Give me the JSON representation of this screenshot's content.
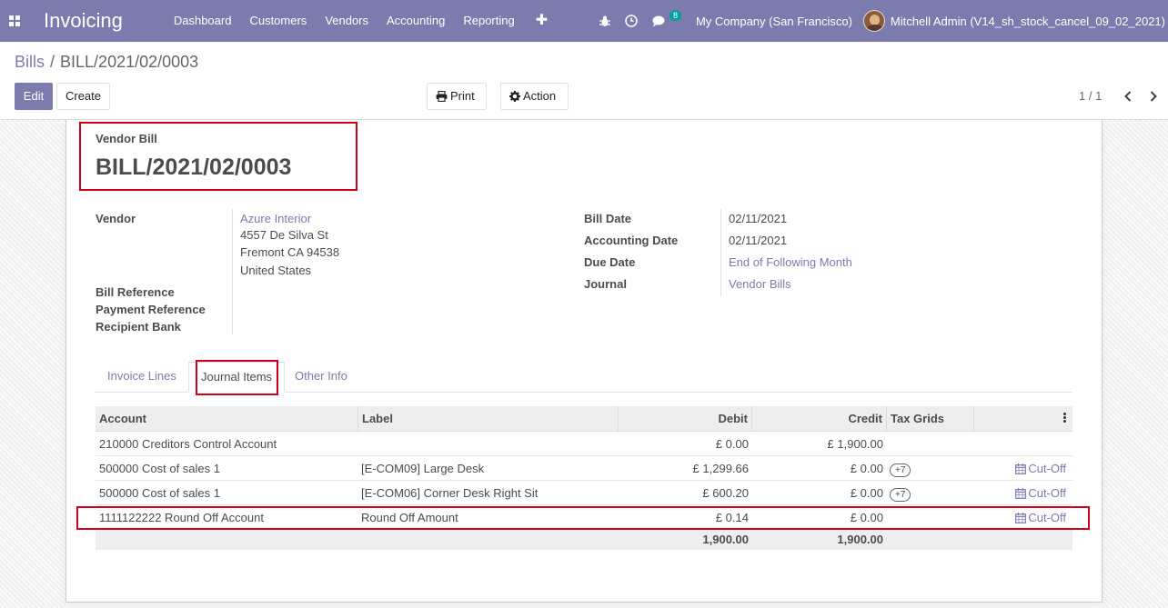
{
  "navbar": {
    "app_title": "Invoicing",
    "menu": [
      "Dashboard",
      "Customers",
      "Vendors",
      "Accounting",
      "Reporting"
    ],
    "chat_count": "8",
    "company": "My Company (San Francisco)",
    "user": "Mitchell Admin (V14_sh_stock_cancel_09_02_2021)"
  },
  "breadcrumb": {
    "parent": "Bills",
    "current": "BILL/2021/02/0003"
  },
  "toolbar": {
    "edit": "Edit",
    "create": "Create",
    "print": "Print",
    "action": "Action",
    "pager": "1 / 1"
  },
  "form": {
    "doc_type": "Vendor Bill",
    "doc_name": "BILL/2021/02/0003",
    "vendor_label": "Vendor",
    "vendor_name": "Azure Interior",
    "vendor_addr1": "4557 De Silva St",
    "vendor_addr2": "Fremont CA 94538",
    "vendor_addr3": "United States",
    "bill_ref_label": "Bill Reference",
    "pay_ref_label": "Payment Reference",
    "bank_label": "Recipient Bank",
    "bill_date_label": "Bill Date",
    "bill_date": "02/11/2021",
    "acc_date_label": "Accounting Date",
    "acc_date": "02/11/2021",
    "due_date_label": "Due Date",
    "due_date": "End of Following Month",
    "journal_label": "Journal",
    "journal": "Vendor Bills"
  },
  "tabs": [
    "Invoice Lines",
    "Journal Items",
    "Other Info"
  ],
  "table": {
    "headers": {
      "account": "Account",
      "label": "Label",
      "debit": "Debit",
      "credit": "Credit",
      "tax": "Tax Grids"
    },
    "rows": [
      {
        "account": "210000 Creditors Control Account",
        "label": "",
        "debit": "£ 0.00",
        "credit": "£ 1,900.00",
        "tax": "",
        "cutoff": ""
      },
      {
        "account": "500000 Cost of sales 1",
        "label": "[E-COM09] Large Desk",
        "debit": "£ 1,299.66",
        "credit": "£ 0.00",
        "tax": "+7",
        "cutoff": "Cut-Off"
      },
      {
        "account": "500000 Cost of sales 1",
        "label": "[E-COM06] Corner Desk Right Sit",
        "debit": "£ 600.20",
        "credit": "£ 0.00",
        "tax": "+7",
        "cutoff": "Cut-Off"
      },
      {
        "account": "1111122222 Round Off Account",
        "label": "Round Off Amount",
        "debit": "£ 0.14",
        "credit": "£ 0.00",
        "tax": "",
        "cutoff": "Cut-Off"
      }
    ],
    "totals": {
      "debit": "1,900.00",
      "credit": "1,900.00"
    }
  },
  "colors": {
    "brand": "#7c7bad",
    "highlight": "#d0021b",
    "badge": "#00a09d"
  }
}
